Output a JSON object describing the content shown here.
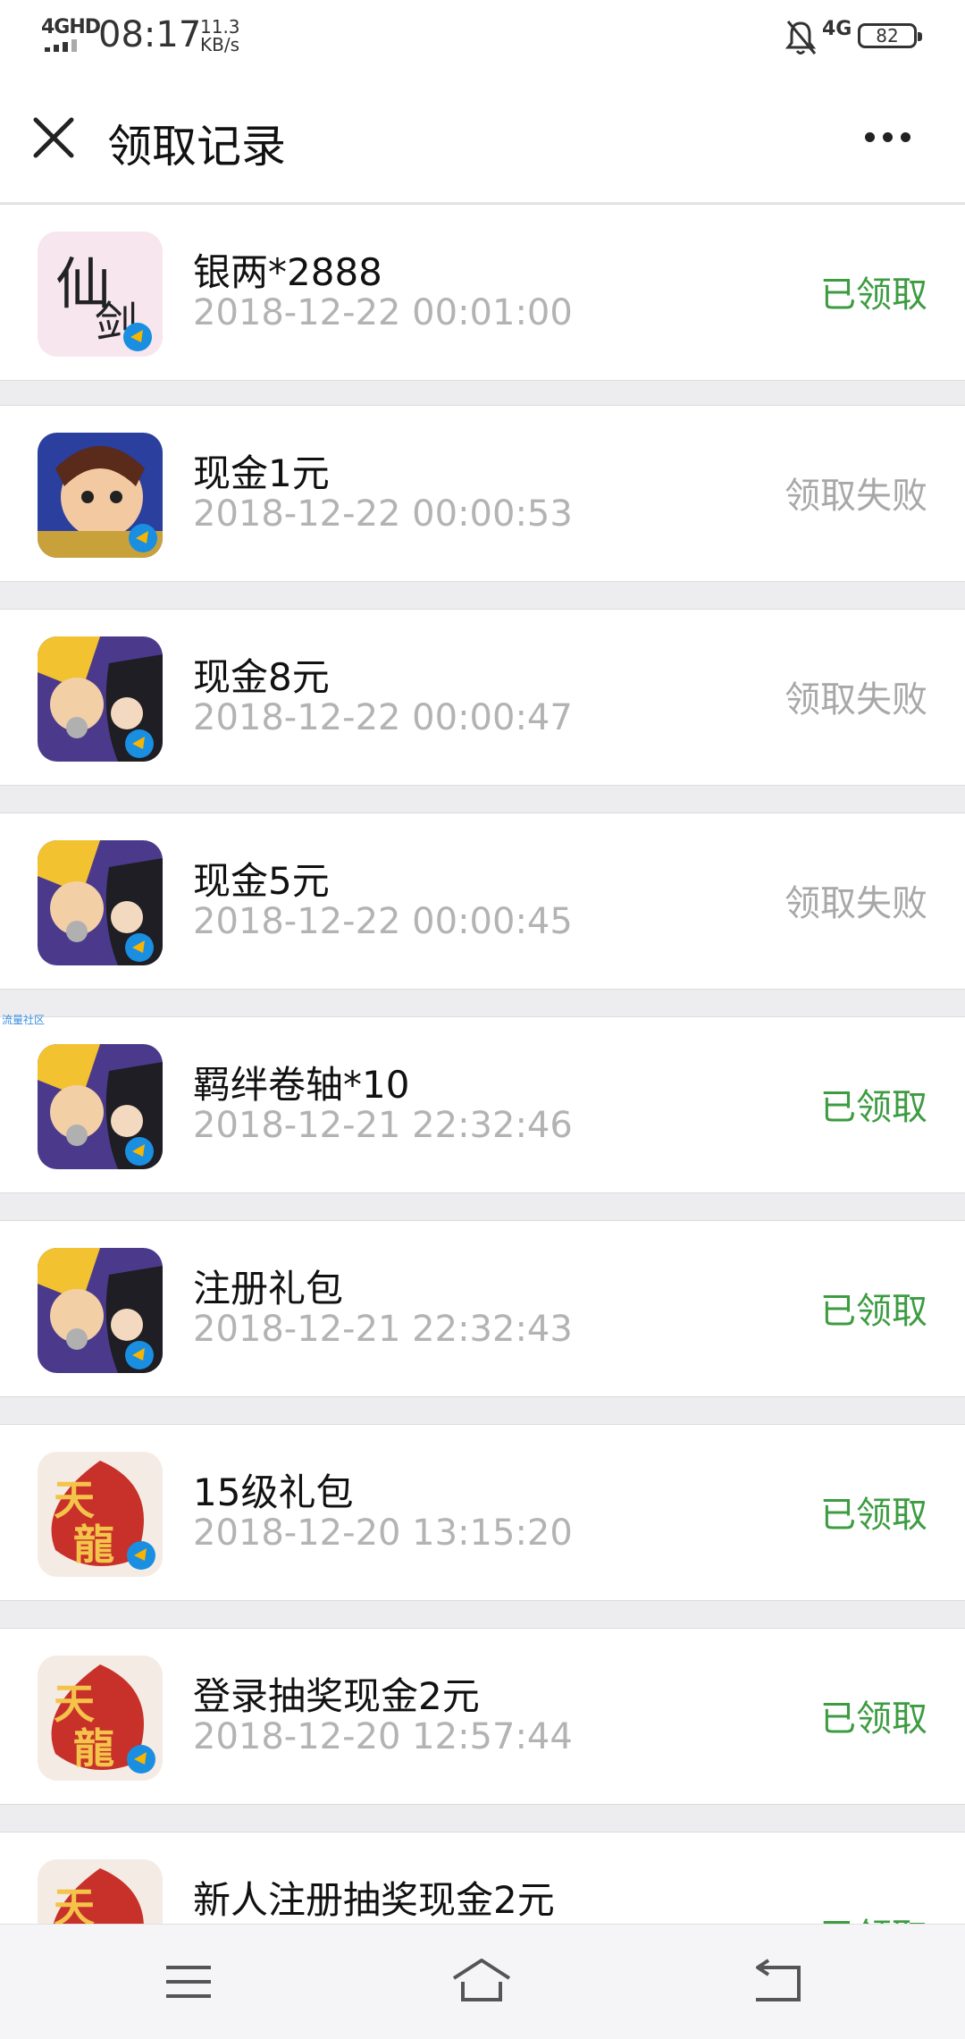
{
  "status_bar": {
    "signal": "4GHD",
    "time": "08:17",
    "speed_value": "11.3",
    "speed_unit": "KB/s",
    "network": "4G",
    "battery": "82"
  },
  "header": {
    "title": "领取记录",
    "close_icon": "close-icon",
    "more_icon": "more-icon"
  },
  "records": [
    {
      "name": "银两*2888",
      "time": "2018-12-22 00:01:00",
      "status": "已领取",
      "icon": "game-xianjian-icon"
    },
    {
      "name": "现金1元",
      "time": "2018-12-22 00:00:53",
      "status": "领取失败",
      "icon": "game-saint-seiya-icon"
    },
    {
      "name": "现金8元",
      "time": "2018-12-22 00:00:47",
      "status": "领取失败",
      "icon": "game-naruto-icon"
    },
    {
      "name": "现金5元",
      "time": "2018-12-22 00:00:45",
      "status": "领取失败",
      "icon": "game-naruto-icon"
    },
    {
      "name": "羁绊卷轴*10",
      "time": "2018-12-21 22:32:46",
      "status": "已领取",
      "icon": "game-naruto-icon"
    },
    {
      "name": "注册礼包",
      "time": "2018-12-21 22:32:43",
      "status": "已领取",
      "icon": "game-naruto-icon"
    },
    {
      "name": "15级礼包",
      "time": "2018-12-20 13:15:20",
      "status": "已领取",
      "icon": "game-tianlong-icon"
    },
    {
      "name": "登录抽奖现金2元",
      "time": "2018-12-20 12:57:44",
      "status": "已领取",
      "icon": "game-tianlong-icon"
    },
    {
      "name": "新人注册抽奖现金2元",
      "time": "",
      "status": "已领取",
      "icon": "game-tianlong-icon"
    }
  ],
  "watermark": "流量社区",
  "colors": {
    "success": "#3d9c41",
    "failed": "#a8a8a8",
    "background": "#ededf0"
  },
  "bottom_nav": {
    "menu_icon": "menu-icon",
    "home_icon": "home-icon",
    "back_icon": "back-icon"
  }
}
